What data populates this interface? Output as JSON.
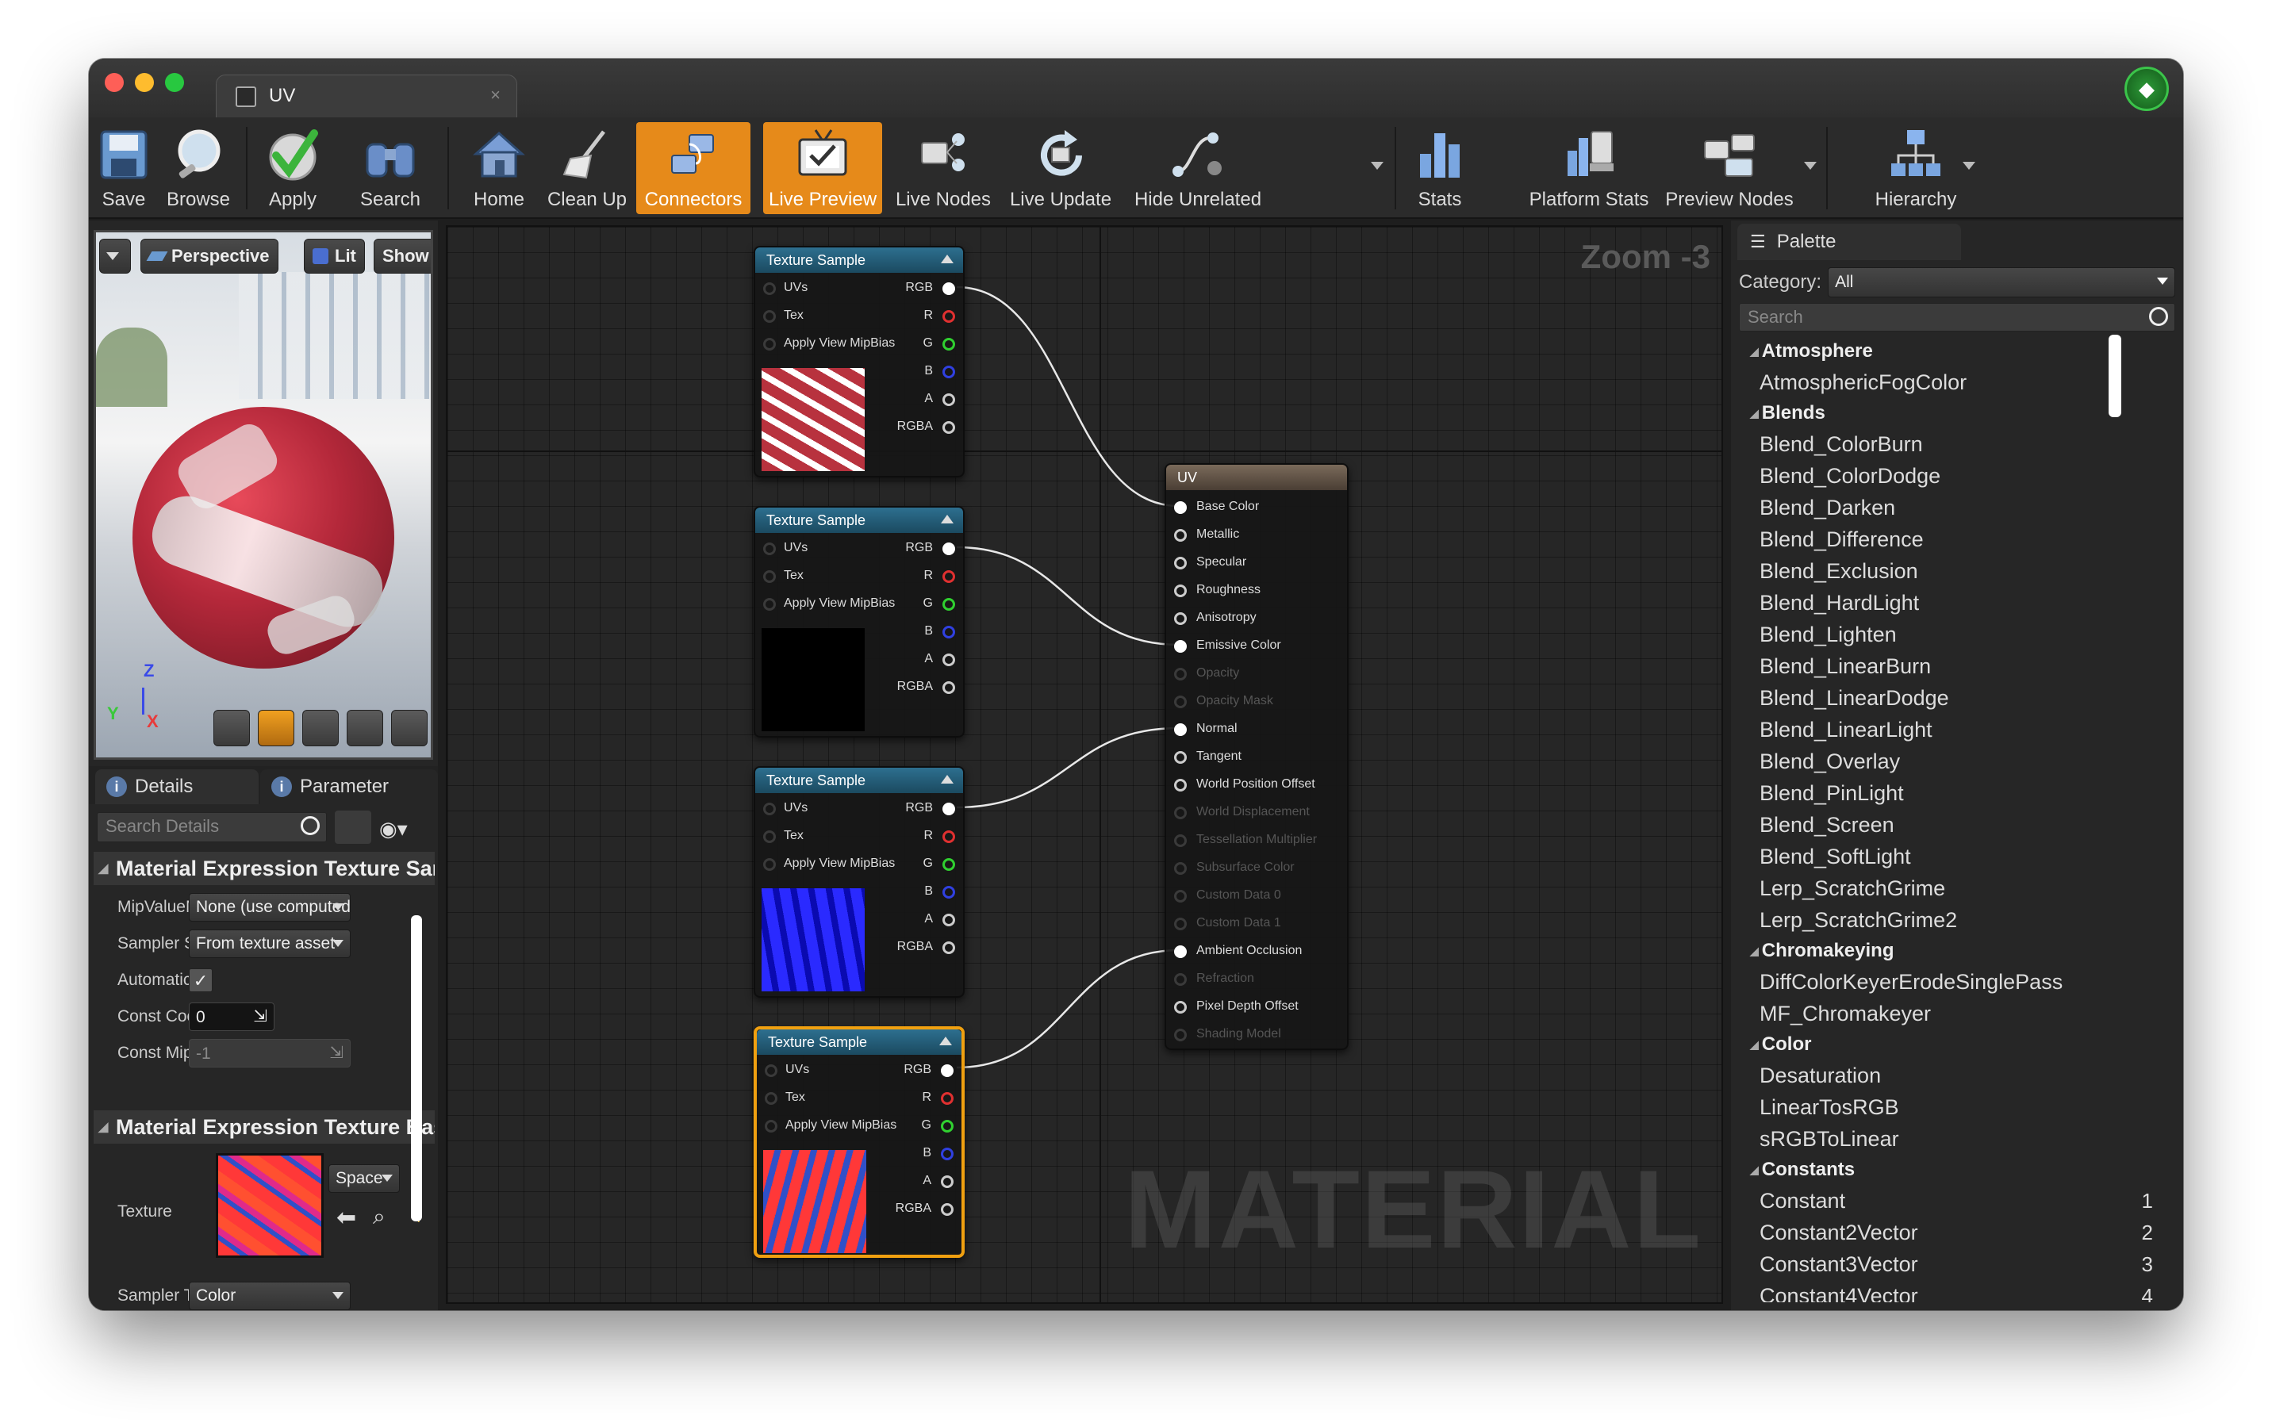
{
  "window": {
    "tab_title": "UV",
    "tab_close": "×"
  },
  "toolbar": {
    "buttons": [
      {
        "id": "save",
        "label": "Save",
        "icon": "floppy-icon",
        "active": false
      },
      {
        "id": "browse",
        "label": "Browse",
        "icon": "magnifier-icon",
        "active": false
      },
      {
        "id": "apply",
        "label": "Apply",
        "icon": "checkmark-icon",
        "active": false
      },
      {
        "id": "search",
        "label": "Search",
        "icon": "binoculars-icon",
        "active": false
      },
      {
        "id": "home",
        "label": "Home",
        "icon": "house-icon",
        "active": false
      },
      {
        "id": "cleanup",
        "label": "Clean Up",
        "icon": "broom-icon",
        "active": false
      },
      {
        "id": "connectors",
        "label": "Connectors",
        "icon": "connectors-icon",
        "active": true
      },
      {
        "id": "livepreview",
        "label": "Live Preview",
        "icon": "tv-icon",
        "active": true
      },
      {
        "id": "livenodes",
        "label": "Live Nodes",
        "icon": "live-nodes-icon",
        "active": false
      },
      {
        "id": "liveupdate",
        "label": "Live Update",
        "icon": "refresh-icon",
        "active": false
      },
      {
        "id": "hideunrelated",
        "label": "Hide Unrelated",
        "icon": "hide-unrelated-icon",
        "active": false
      },
      {
        "id": "stats",
        "label": "Stats",
        "icon": "bar-chart-icon",
        "active": false
      },
      {
        "id": "platformstats",
        "label": "Platform Stats",
        "icon": "platform-stats-icon",
        "active": false
      },
      {
        "id": "previewnodes",
        "label": "Preview Nodes",
        "icon": "preview-nodes-icon",
        "active": false
      },
      {
        "id": "hierarchy",
        "label": "Hierarchy",
        "icon": "hierarchy-icon",
        "active": false
      }
    ]
  },
  "viewport": {
    "perspective_label": "Perspective",
    "lit_label": "Lit",
    "show_label": "Show",
    "axis_z": "Z",
    "axis_y": "Y",
    "axis_x": "X"
  },
  "details": {
    "tab_details": "Details",
    "tab_parameters": "Parameter",
    "search_placeholder": "Search Details",
    "section1": "Material Expression Texture Sample",
    "props": [
      {
        "label": "MipValueMode",
        "value": "None (use computed)"
      },
      {
        "label": "Sampler Source",
        "value": "From texture asset"
      },
      {
        "label": "Automatic View MipBias",
        "checked": "✓"
      },
      {
        "label": "Const Coordinate",
        "value": "0"
      },
      {
        "label": "Const Mip Value",
        "value": "-1"
      }
    ],
    "section2": "Material Expression Texture Base",
    "texture_label": "Texture",
    "space_label": "Space",
    "sampler_type_label": "Sampler Type",
    "sampler_type_value": "Color"
  },
  "graph": {
    "zoom": "Zoom -3",
    "watermark": "MATERIAL",
    "texture_nodes": [
      {
        "title": "Texture Sample",
        "thumb_colors": [
          "#b8323e",
          "#ffffff"
        ],
        "selected": false
      },
      {
        "title": "Texture Sample",
        "thumb_colors": [
          "#000000",
          "#3a6a3a"
        ],
        "selected": false
      },
      {
        "title": "Texture Sample",
        "thumb_colors": [
          "#2a2aff",
          "#0a0ab0"
        ],
        "selected": false
      },
      {
        "title": "Texture Sample",
        "thumb_colors": [
          "#ff3838",
          "#3050c8"
        ],
        "selected": true
      }
    ],
    "texture_pins_left": [
      "UVs",
      "Tex",
      "Apply View MipBias"
    ],
    "texture_pins_right": [
      "RGB",
      "R",
      "G",
      "B",
      "A",
      "RGBA"
    ],
    "material_node": {
      "title": "UV",
      "pins": [
        {
          "label": "Base Color",
          "enabled": true,
          "connected": true
        },
        {
          "label": "Metallic",
          "enabled": true,
          "connected": false
        },
        {
          "label": "Specular",
          "enabled": true,
          "connected": false
        },
        {
          "label": "Roughness",
          "enabled": true,
          "connected": false
        },
        {
          "label": "Anisotropy",
          "enabled": true,
          "connected": false
        },
        {
          "label": "Emissive Color",
          "enabled": true,
          "connected": true
        },
        {
          "label": "Opacity",
          "enabled": false,
          "connected": false
        },
        {
          "label": "Opacity Mask",
          "enabled": false,
          "connected": false
        },
        {
          "label": "Normal",
          "enabled": true,
          "connected": true
        },
        {
          "label": "Tangent",
          "enabled": true,
          "connected": false
        },
        {
          "label": "World Position Offset",
          "enabled": true,
          "connected": false
        },
        {
          "label": "World Displacement",
          "enabled": false,
          "connected": false
        },
        {
          "label": "Tessellation Multiplier",
          "enabled": false,
          "connected": false
        },
        {
          "label": "Subsurface Color",
          "enabled": false,
          "connected": false
        },
        {
          "label": "Custom Data 0",
          "enabled": false,
          "connected": false
        },
        {
          "label": "Custom Data 1",
          "enabled": false,
          "connected": false
        },
        {
          "label": "Ambient Occlusion",
          "enabled": true,
          "connected": true
        },
        {
          "label": "Refraction",
          "enabled": false,
          "connected": false
        },
        {
          "label": "Pixel Depth Offset",
          "enabled": true,
          "connected": false
        },
        {
          "label": "Shading Model",
          "enabled": false,
          "connected": false
        }
      ]
    }
  },
  "palette": {
    "tab": "Palette",
    "category_label": "Category:",
    "category_value": "All",
    "search_placeholder": "Search",
    "items": [
      {
        "text": "Atmosphere",
        "cat": true
      },
      {
        "text": "AtmosphericFogColor"
      },
      {
        "text": "Blends",
        "cat": true
      },
      {
        "text": "Blend_ColorBurn"
      },
      {
        "text": "Blend_ColorDodge"
      },
      {
        "text": "Blend_Darken"
      },
      {
        "text": "Blend_Difference"
      },
      {
        "text": "Blend_Exclusion"
      },
      {
        "text": "Blend_HardLight"
      },
      {
        "text": "Blend_Lighten"
      },
      {
        "text": "Blend_LinearBurn"
      },
      {
        "text": "Blend_LinearDodge"
      },
      {
        "text": "Blend_LinearLight"
      },
      {
        "text": "Blend_Overlay"
      },
      {
        "text": "Blend_PinLight"
      },
      {
        "text": "Blend_Screen"
      },
      {
        "text": "Blend_SoftLight"
      },
      {
        "text": "Lerp_ScratchGrime"
      },
      {
        "text": "Lerp_ScratchGrime2"
      },
      {
        "text": "Chromakeying",
        "cat": true
      },
      {
        "text": "DiffColorKeyerErodeSinglePass"
      },
      {
        "text": "MF_Chromakeyer"
      },
      {
        "text": "Color",
        "cat": true
      },
      {
        "text": "Desaturation"
      },
      {
        "text": "LinearTosRGB"
      },
      {
        "text": "sRGBToLinear"
      },
      {
        "text": "Constants",
        "cat": true
      },
      {
        "text": "Constant",
        "hotkey": "1"
      },
      {
        "text": "Constant2Vector",
        "hotkey": "2"
      },
      {
        "text": "Constant3Vector",
        "hotkey": "3"
      },
      {
        "text": "Constant4Vector",
        "hotkey": "4"
      }
    ]
  }
}
